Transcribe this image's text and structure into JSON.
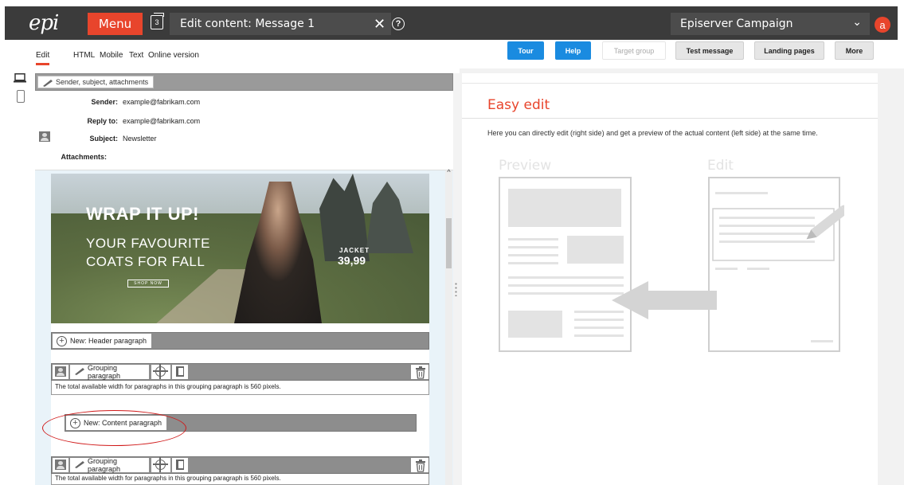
{
  "topbar": {
    "logo": "epi",
    "menu_label": "Menu",
    "badge_count": "3",
    "title": "Edit content: Message 1",
    "campaign": "Episerver Campaign",
    "avatar_letter": "a"
  },
  "tabs": {
    "edit": "Edit",
    "html": "HTML",
    "mobile": "Mobile",
    "text": "Text",
    "online": "Online version"
  },
  "actions": {
    "tour": "Tour",
    "help": "Help",
    "target_group": "Target group",
    "test_message": "Test message",
    "landing_pages": "Landing pages",
    "more": "More"
  },
  "sender_section": {
    "tag": "Sender, subject, attachments",
    "sender_label": "Sender:",
    "sender_value": "example@fabrikam.com",
    "reply_label": "Reply to:",
    "reply_value": "example@fabrikam.com",
    "subject_label": "Subject:",
    "subject_value": "Newsletter",
    "attachments_label": "Attachments:"
  },
  "hero": {
    "title": "WRAP IT UP!",
    "sub1": "YOUR FAVOURITE",
    "sub2": "COATS FOR FALL",
    "shop": "SHOP NOW",
    "jacket": "JACKET",
    "price": "39,99"
  },
  "paragraphs": {
    "new_header": "New: Header paragraph",
    "grouping": "Grouping paragraph",
    "group_note": "The total available width for paragraphs in this grouping paragraph is 560 pixels.",
    "new_content": "New: Content paragraph"
  },
  "easy_edit": {
    "title": "Easy edit",
    "description": "Here you can directly edit (right side) and get a preview of the actual content (left side) at the same time.",
    "preview_label": "Preview",
    "edit_label": "Edit"
  },
  "colors": {
    "accent": "#e8452c",
    "primary_button": "#1a8be0",
    "topbar": "#3b3b3b",
    "annotation": "#d01818"
  }
}
